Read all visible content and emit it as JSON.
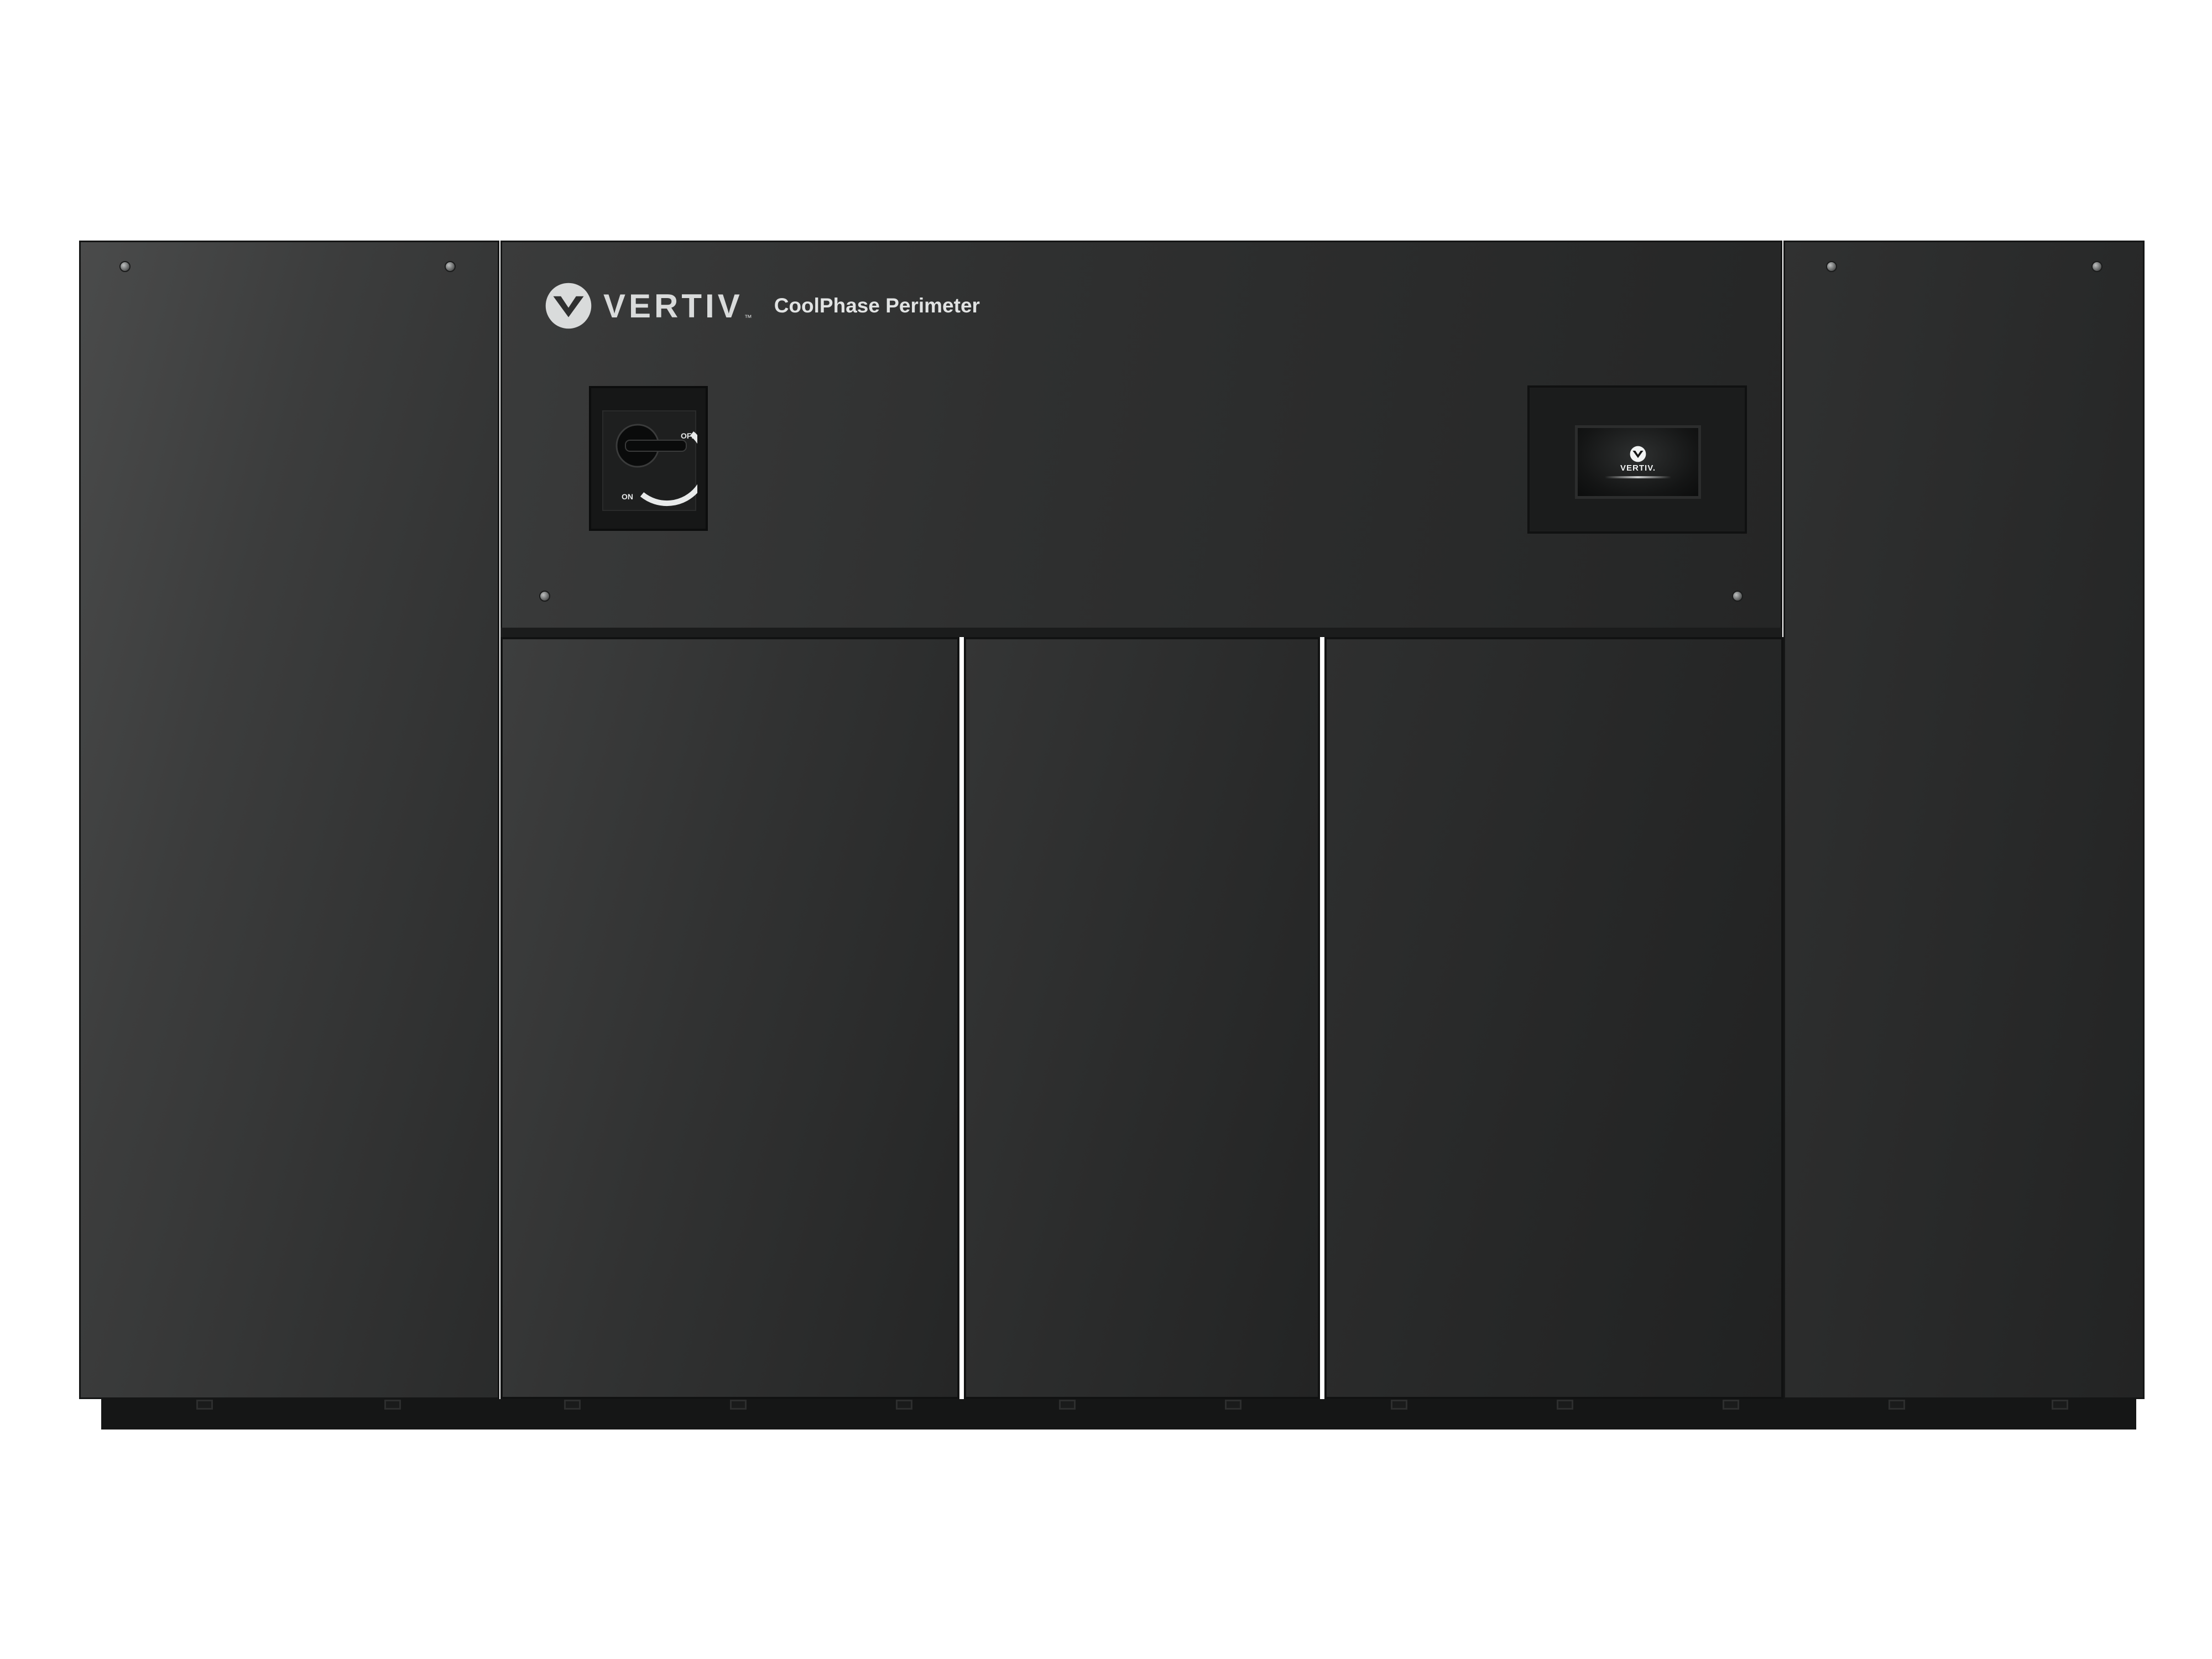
{
  "brand": {
    "name": "VERTIV",
    "trademark": "™",
    "product": "CoolPhase Perimeter"
  },
  "disconnect_switch": {
    "off_label": "OFF",
    "on_label": "ON"
  },
  "display": {
    "brand": "VERTIV."
  },
  "colors": {
    "cabinet": "#2f3030",
    "background": "#ffffff"
  },
  "icons": {
    "brand_logo": "vertiv-logo-icon",
    "display_logo": "vertiv-logo-icon"
  }
}
